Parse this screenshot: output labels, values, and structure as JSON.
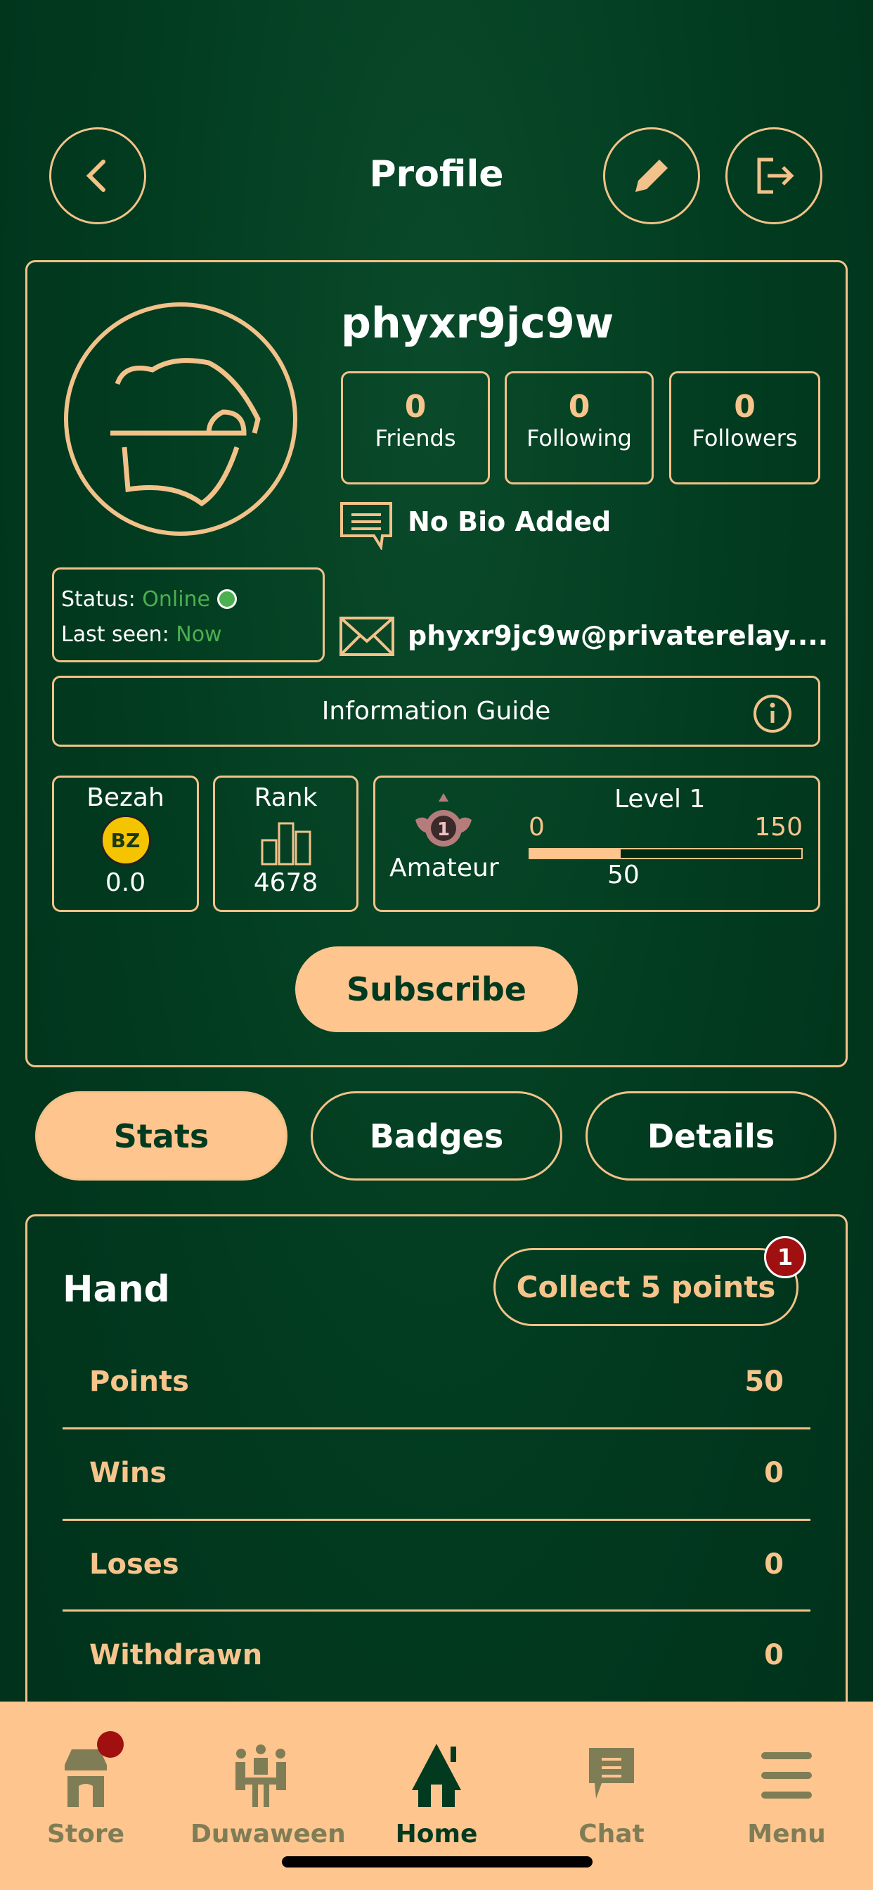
{
  "header": {
    "title": "Profile",
    "back_icon": "chevron-left-icon",
    "edit_icon": "pencil-icon",
    "logout_icon": "logout-icon"
  },
  "profile": {
    "username": "phyxr9jc9w",
    "stats": [
      {
        "value": "0",
        "label": "Friends"
      },
      {
        "value": "0",
        "label": "Following"
      },
      {
        "value": "0",
        "label": "Followers"
      }
    ],
    "bio": "No Bio Added",
    "status_label": "Status:",
    "status_value": "Online",
    "last_seen_label": "Last seen:",
    "last_seen_value": "Now",
    "email": "phyxr9jc9w@privaterelay....",
    "info_guide": "Information Guide",
    "bezah_label": "Bezah",
    "bezah_value": "0.0",
    "rank_label": "Rank",
    "rank_value": "4678",
    "level_label": "Level 1",
    "level_title": "Amateur",
    "level_min": "0",
    "level_max": "150",
    "level_current": "50",
    "level_progress_fraction": 0.333,
    "subscribe": "Subscribe"
  },
  "tabs": [
    {
      "label": "Stats",
      "active": true
    },
    {
      "label": "Badges"
    },
    {
      "label": "Details"
    }
  ],
  "hand": {
    "title": "Hand",
    "collect": "Collect 5 points",
    "collect_badge": "1",
    "rows": [
      {
        "label": "Points",
        "value": "50"
      },
      {
        "label": "Wins",
        "value": "0"
      },
      {
        "label": "Loses",
        "value": "0"
      },
      {
        "label": "Withdrawn",
        "value": "0"
      }
    ]
  },
  "nav": [
    {
      "label": "Store",
      "icon": "store-icon"
    },
    {
      "label": "Duwaween",
      "icon": "table-people-icon"
    },
    {
      "label": "Home",
      "icon": "home-icon",
      "active": true
    },
    {
      "label": "Chat",
      "icon": "chat-icon"
    },
    {
      "label": "Menu",
      "icon": "menu-icon"
    }
  ],
  "colors": {
    "background": "#013a1f",
    "accent": "#f7c48c",
    "nav_bg": "#ffc58f",
    "online": "#4caf50",
    "badge": "#a01010"
  }
}
